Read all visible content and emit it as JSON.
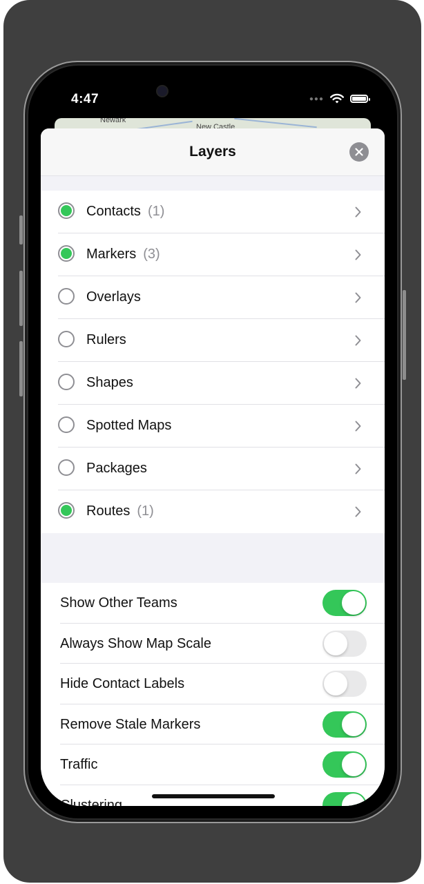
{
  "status_bar": {
    "time": "4:47"
  },
  "map": {
    "labels": [
      "Newark",
      "New Castle"
    ]
  },
  "sheet": {
    "title": "Layers"
  },
  "layers": [
    {
      "label": "Contacts",
      "count": "(1)",
      "selected": true
    },
    {
      "label": "Markers",
      "count": "(3)",
      "selected": true
    },
    {
      "label": "Overlays",
      "count": "",
      "selected": false
    },
    {
      "label": "Rulers",
      "count": "",
      "selected": false
    },
    {
      "label": "Shapes",
      "count": "",
      "selected": false
    },
    {
      "label": "Spotted Maps",
      "count": "",
      "selected": false
    },
    {
      "label": "Packages",
      "count": "",
      "selected": false
    },
    {
      "label": "Routes",
      "count": "(1)",
      "selected": true
    }
  ],
  "settings": [
    {
      "label": "Show Other Teams",
      "on": true
    },
    {
      "label": "Always Show Map Scale",
      "on": false
    },
    {
      "label": "Hide Contact Labels",
      "on": false
    },
    {
      "label": "Remove Stale Markers",
      "on": true
    },
    {
      "label": "Traffic",
      "on": true
    },
    {
      "label": "Clustering",
      "on": true
    }
  ],
  "colors": {
    "accent_green": "#34c759",
    "radio_gray": "#8e8e93"
  },
  "icons": {
    "close": "close-icon",
    "chevron": "chevron-right-icon",
    "wifi": "wifi-icon",
    "battery": "battery-icon"
  }
}
